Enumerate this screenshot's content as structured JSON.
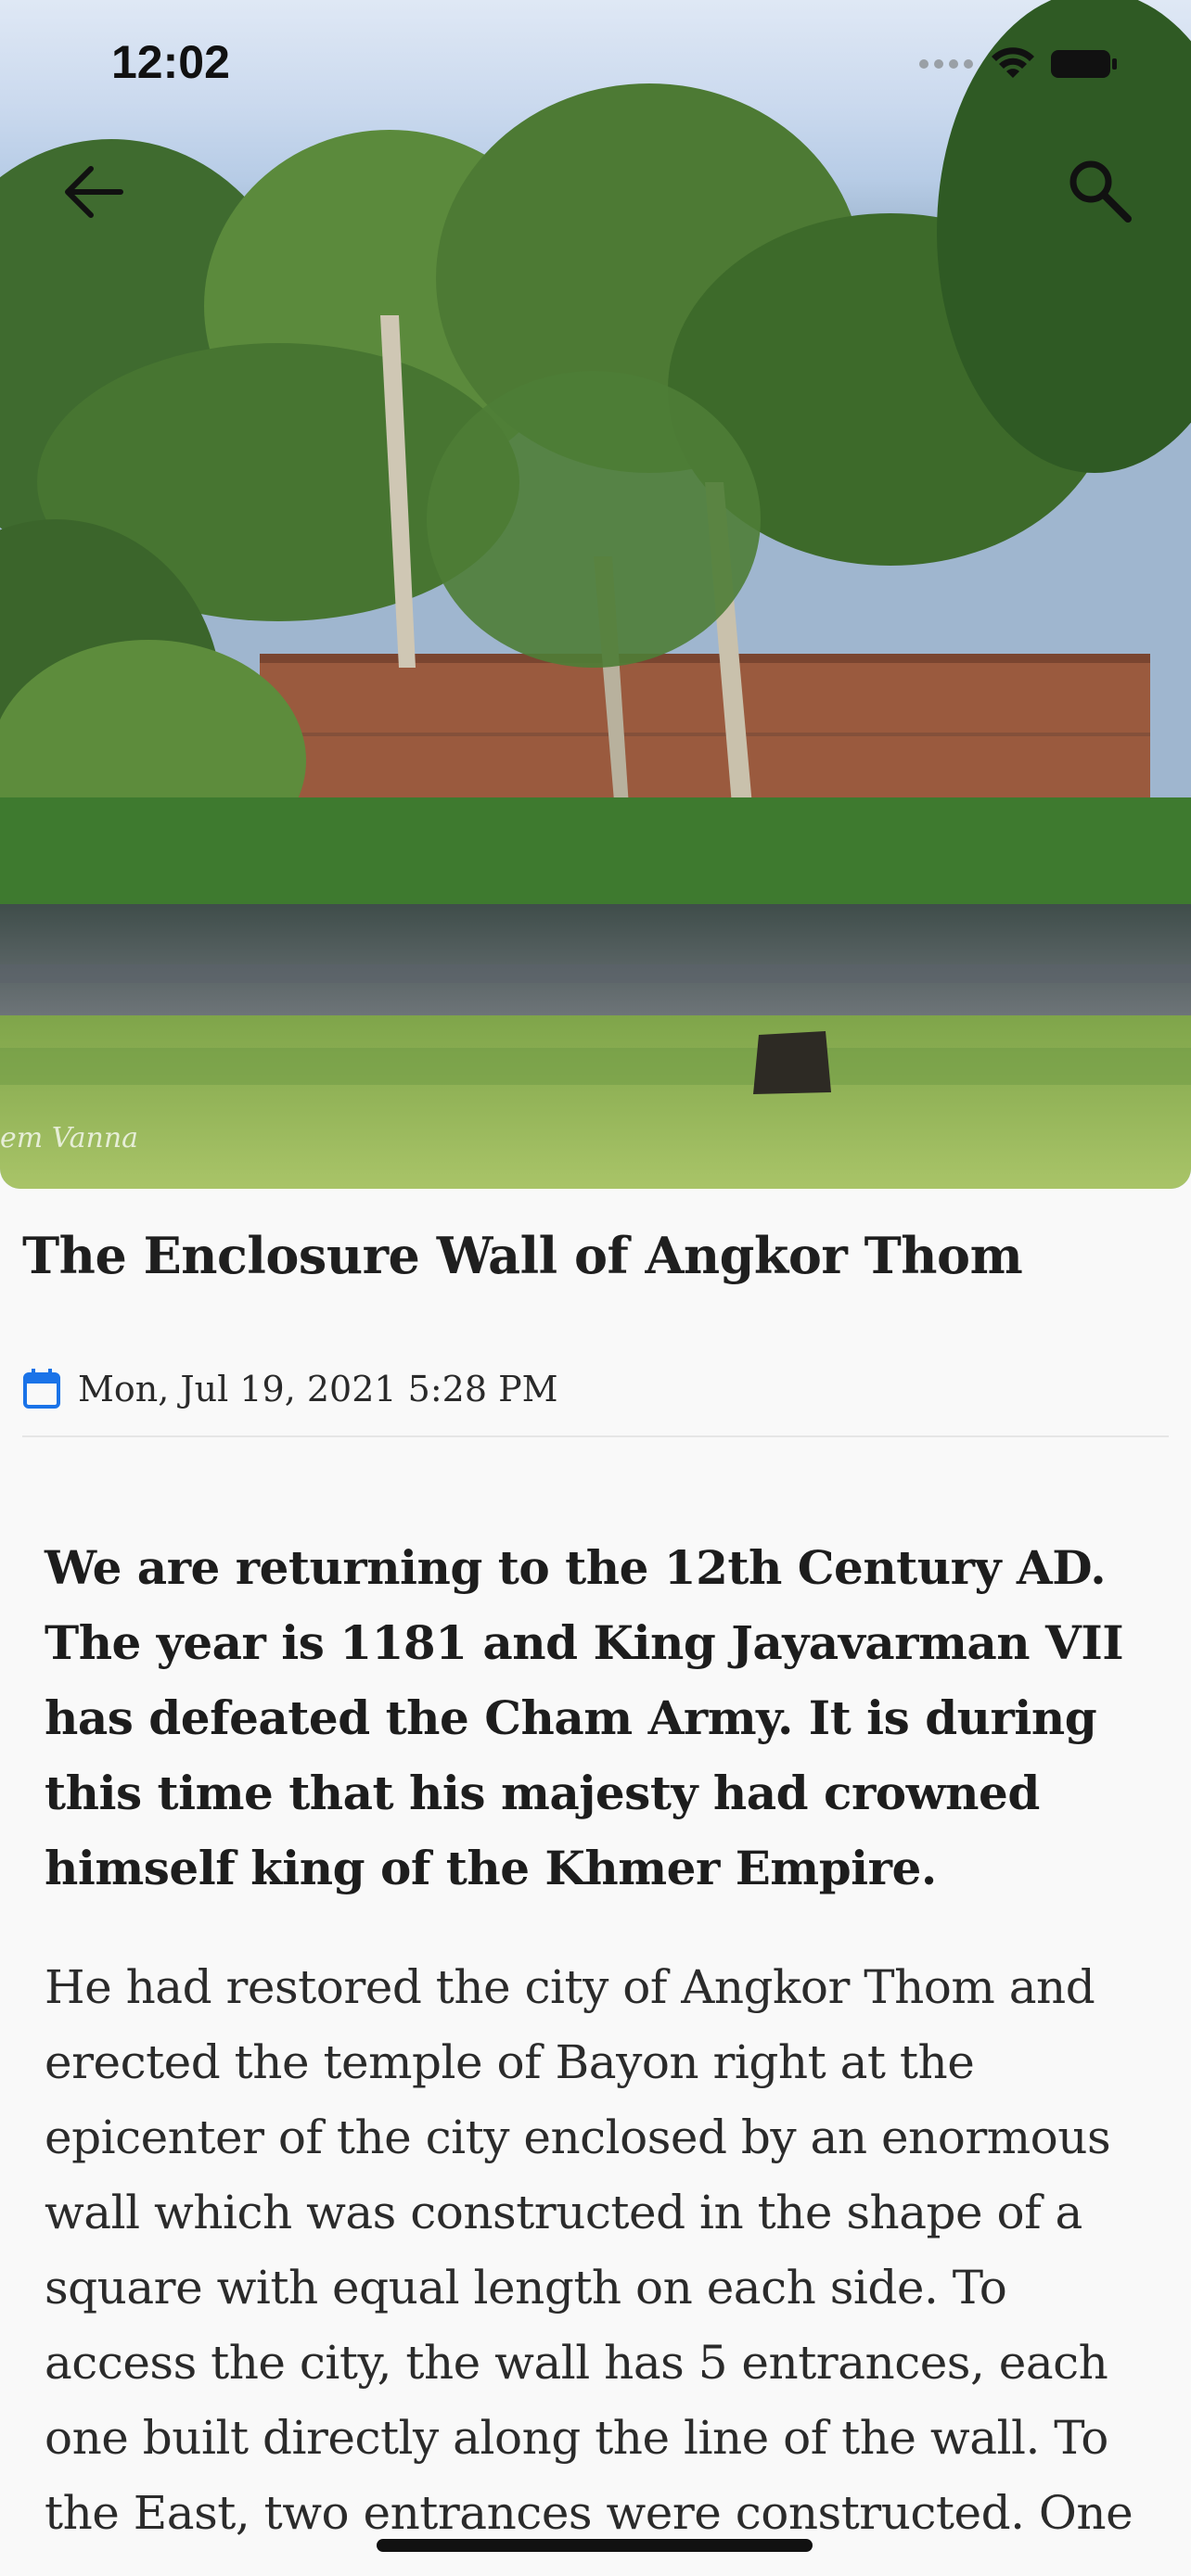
{
  "status_bar": {
    "time": "12:02"
  },
  "nav": {
    "back_icon": "arrow-left-icon",
    "search_icon": "search-icon"
  },
  "hero": {
    "photo_credit": "em Vanna"
  },
  "article": {
    "title": "The Enclosure Wall of Angkor Thom",
    "date_icon": "calendar-icon",
    "date": "Mon, Jul 19, 2021 5:28 PM",
    "lead": "We are returning to the 12th Century AD. The year is 1181 and King Jayavarman VII has defeated the Cham Army. It is during this time that his majesty had crowned himself king of the Khmer Empire.",
    "body": "He had restored the city of Angkor Thom and erected the temple of Bayon right at the epicenter of the city enclosed by an enormous wall which was constructed in the shape of a square with equal length on each side. To access the city, the wall has 5 entrances, each one built directly along the line of the wall. To the East, two entrances were constructed. One"
  },
  "colors": {
    "accent": "#1a73e8",
    "background": "#f9f9f9",
    "text": "#1d1d1d"
  }
}
